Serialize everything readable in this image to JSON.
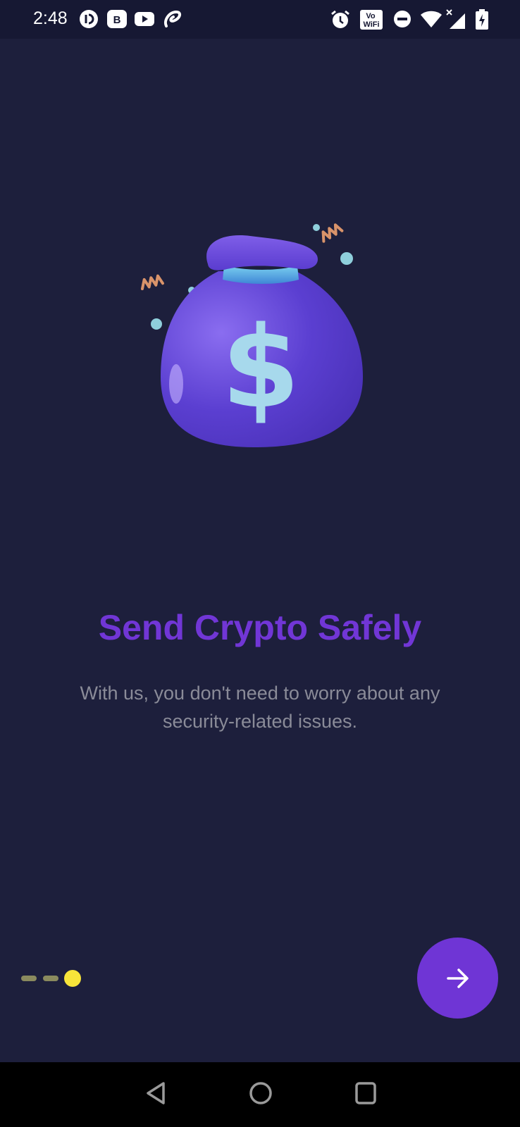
{
  "status_bar": {
    "time": "2:48",
    "left_icons": [
      "chat-app-icon",
      "b-app-icon",
      "youtube-icon",
      "airtel-icon"
    ],
    "right_icons": [
      "alarm-icon",
      "vowifi-icon",
      "dnd-icon",
      "wifi-icon",
      "signal-icon",
      "battery-charging-icon"
    ],
    "vowifi_label_top": "Vo",
    "vowifi_label_bottom": "WiFi"
  },
  "onboarding": {
    "illustration": "money-bag-dollar-icon",
    "title": "Send Crypto Safely",
    "subtitle_line1": "With us, you don't need to worry about any",
    "subtitle_line2": "security-related issues."
  },
  "pager": {
    "total_pages": 3,
    "current_page": 3
  },
  "next_button": {
    "icon": "arrow-right-icon"
  },
  "navigation_bar": {
    "buttons": [
      "back-triangle-icon",
      "home-circle-icon",
      "recents-square-icon"
    ]
  },
  "colors": {
    "background": "#1d1f3c",
    "accent": "#6f35d5",
    "title": "#7136d6",
    "subtitle": "#8a8b98",
    "indicator_active": "#f7e43a",
    "indicator_inactive": "#8a8a5e"
  }
}
